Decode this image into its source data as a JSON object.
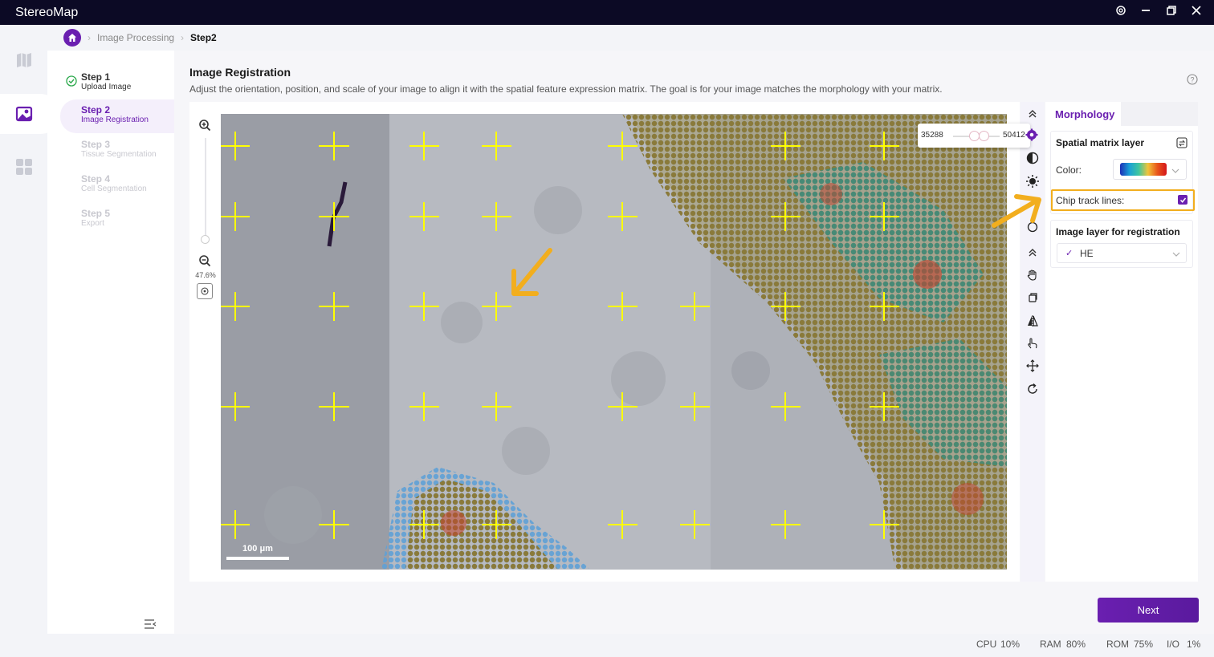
{
  "app": {
    "title": "StereoMap"
  },
  "window_controls": [
    "settings-icon",
    "minimize-icon",
    "restore-icon",
    "close-icon"
  ],
  "rail": {
    "items": [
      "map-icon",
      "image-icon",
      "apps-icon"
    ],
    "active": "image-icon"
  },
  "breadcrumb": {
    "items": [
      "Image Processing",
      "Step2"
    ]
  },
  "steps": [
    {
      "label": "Step 1",
      "sub": "Upload Image",
      "state": "done"
    },
    {
      "label": "Step 2",
      "sub": "Image Registration",
      "state": "active"
    },
    {
      "label": "Step 3",
      "sub": "Tissue Segmentation",
      "state": "disabled"
    },
    {
      "label": "Step 4",
      "sub": "Cell Segmentation",
      "state": "disabled"
    },
    {
      "label": "Step 5",
      "sub": "Export",
      "state": "disabled"
    }
  ],
  "page": {
    "title": "Image Registration",
    "description": "Adjust the orientation, position, and scale of your image to align it with the spatial feature expression matrix. The goal is for your image matches the morphology with your matrix."
  },
  "viewer": {
    "zoom_level": "47.6%",
    "scale_bar": "100 μm",
    "range": {
      "min": "35288",
      "max": "50412"
    }
  },
  "tools": [
    "collapse-up-icon",
    "settings-icon",
    "contrast-icon",
    "brightness-icon",
    "gamma-icon",
    "collapse-up-icon",
    "hand-icon",
    "copy-icon",
    "flip-icon",
    "point-icon",
    "move-icon",
    "rotate-icon"
  ],
  "right_panel": {
    "tab": "Morphology",
    "spatial_matrix": {
      "heading": "Spatial matrix layer",
      "color_label": "Color:",
      "chip_track_label": "Chip track lines:",
      "chip_track_checked": true
    },
    "image_layer": {
      "heading": "Image layer for registration",
      "selected": "HE"
    }
  },
  "actions": {
    "next": "Next"
  },
  "status": {
    "cpu_label": "CPU",
    "cpu": "10%",
    "ram_label": "RAM",
    "ram": "80%",
    "rom_label": "ROM",
    "rom": "75%",
    "io_label": "I/O",
    "io": "1%"
  },
  "colors": {
    "accent": "#6a1fb0",
    "highlight": "#f2ae1e",
    "titlebar": "#0c0a25",
    "track_lines": "#ffff00"
  }
}
